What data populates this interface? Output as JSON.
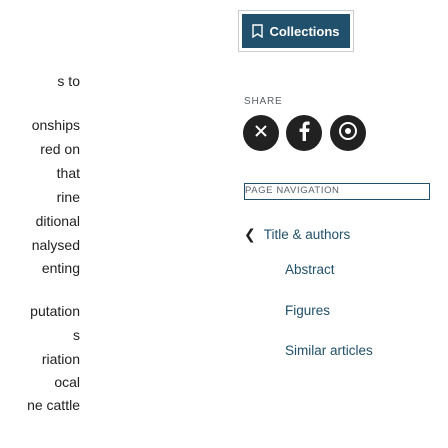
{
  "article_text_lines": [
    "s to",
    "",
    "onships",
    "red on",
    "that",
    "rine",
    "ditional",
    "nalysed",
    "enting",
    "",
    "putation",
    "s",
    "riation",
    "ocal",
    "ne cattle"
  ],
  "collections": {
    "label": "Collections",
    "icon": "bookmark-icon"
  },
  "share": {
    "label": "SHARE",
    "buttons": [
      {
        "name": "share-x-button",
        "icon": "x-icon"
      },
      {
        "name": "share-facebook-button",
        "icon": "facebook-icon"
      },
      {
        "name": "share-reddit-button",
        "icon": "reddit-icon"
      }
    ]
  },
  "page_navigation": {
    "label": "PAGE NAVIGATION",
    "items": [
      {
        "label": "Title & authors",
        "has_chevron": true
      },
      {
        "label": "Abstract"
      },
      {
        "label": "Figures"
      },
      {
        "label": "Similar articles"
      }
    ]
  },
  "colors": {
    "primary": "#20506b",
    "text": "#212121",
    "muted": "#5b616b",
    "social_bg": "#212121"
  }
}
